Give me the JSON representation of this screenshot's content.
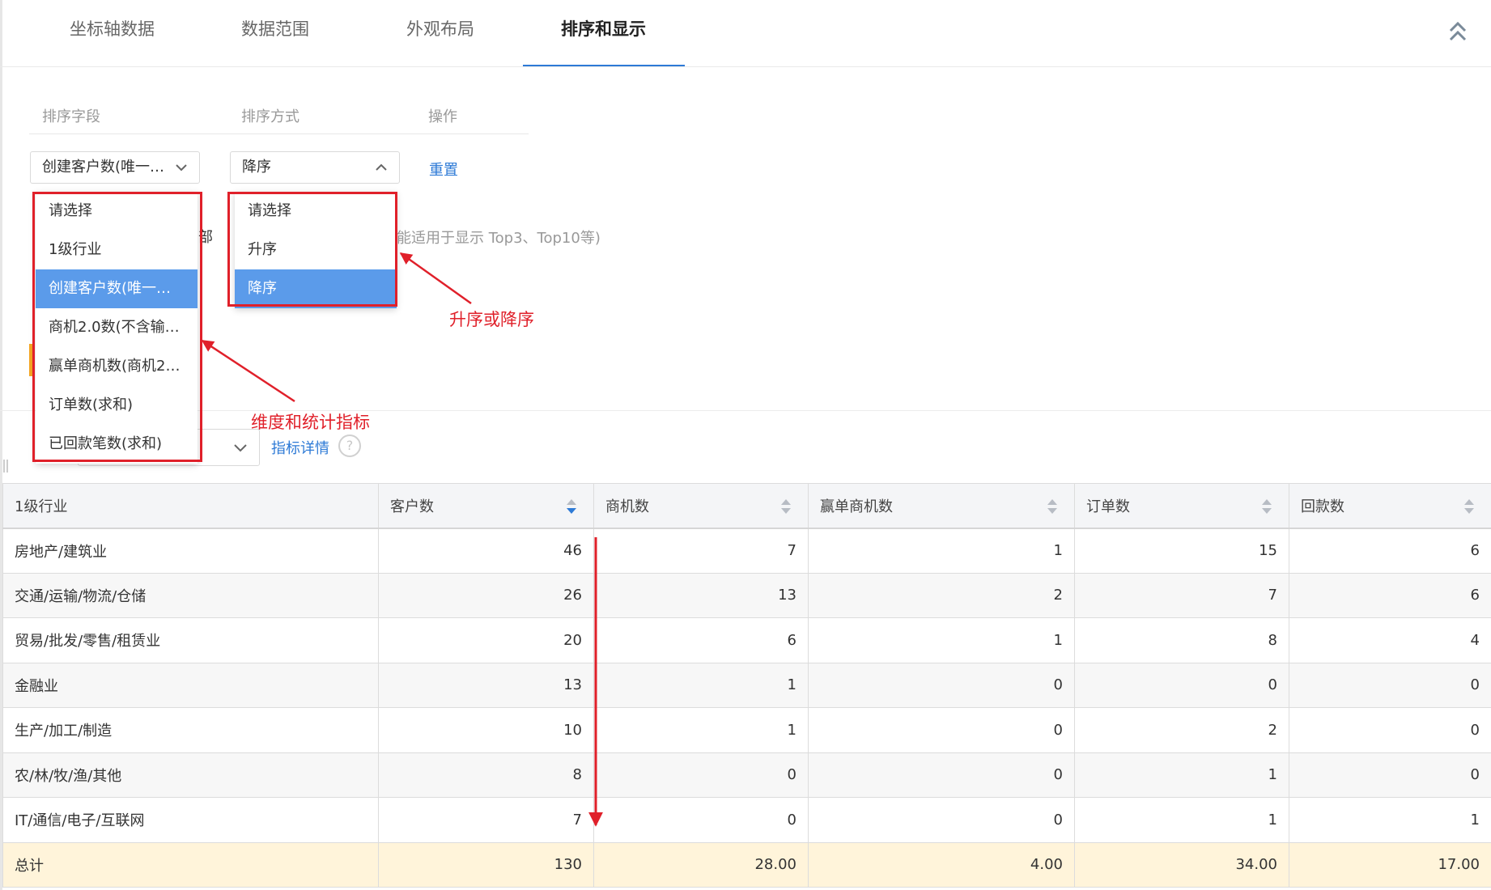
{
  "tabs": [
    {
      "label": "坐标轴数据"
    },
    {
      "label": "数据范围"
    },
    {
      "label": "外观布局"
    },
    {
      "label": "排序和显示"
    }
  ],
  "sort": {
    "headers": {
      "field": "排序字段",
      "order": "排序方式",
      "action": "操作"
    },
    "field_value": "创建客户数(唯一…",
    "order_value": "降序",
    "reset_label": "重置"
  },
  "hidden_row": {
    "partial_label": "部",
    "hint": "能适用于显示 Top3、Top10等)"
  },
  "metric": {
    "detail_link": "指标详情",
    "help_glyph": "?"
  },
  "field_dropdown": [
    {
      "label": "请选择",
      "selected": false
    },
    {
      "label": "1级行业",
      "selected": false
    },
    {
      "label": "创建客户数(唯一…",
      "selected": true
    },
    {
      "label": "商机2.0数(不含输…",
      "selected": false
    },
    {
      "label": "赢单商机数(商机2…",
      "selected": false
    },
    {
      "label": "订单数(求和)",
      "selected": false
    },
    {
      "label": "已回款笔数(求和)",
      "selected": false
    }
  ],
  "order_dropdown": [
    {
      "label": "请选择",
      "selected": false
    },
    {
      "label": "升序",
      "selected": false
    },
    {
      "label": "降序",
      "selected": true
    }
  ],
  "annotations": {
    "order": "升序或降序",
    "fields": "维度和统计指标"
  },
  "table": {
    "columns": [
      "1级行业",
      "客户数",
      "商机数",
      "赢单商机数",
      "订单数",
      "回款数"
    ],
    "rows": [
      [
        "房地产/建筑业",
        "46",
        "7",
        "1",
        "15",
        "6"
      ],
      [
        "交通/运输/物流/仓储",
        "26",
        "13",
        "2",
        "7",
        "6"
      ],
      [
        "贸易/批发/零售/租赁业",
        "20",
        "6",
        "1",
        "8",
        "4"
      ],
      [
        "金融业",
        "13",
        "1",
        "0",
        "0",
        "0"
      ],
      [
        "生产/加工/制造",
        "10",
        "1",
        "0",
        "2",
        "0"
      ],
      [
        "农/林/牧/渔/其他",
        "8",
        "0",
        "0",
        "1",
        "0"
      ],
      [
        "IT/通信/电子/互联网",
        "7",
        "0",
        "0",
        "1",
        "1"
      ]
    ],
    "total": [
      "总计",
      "130",
      "28.00",
      "4.00",
      "34.00",
      "17.00"
    ]
  },
  "colors": {
    "accent": "#2d7ad6",
    "selected_item": "#5b9bea",
    "annotation_red": "#e0202a",
    "total_row": "#fff4da"
  }
}
